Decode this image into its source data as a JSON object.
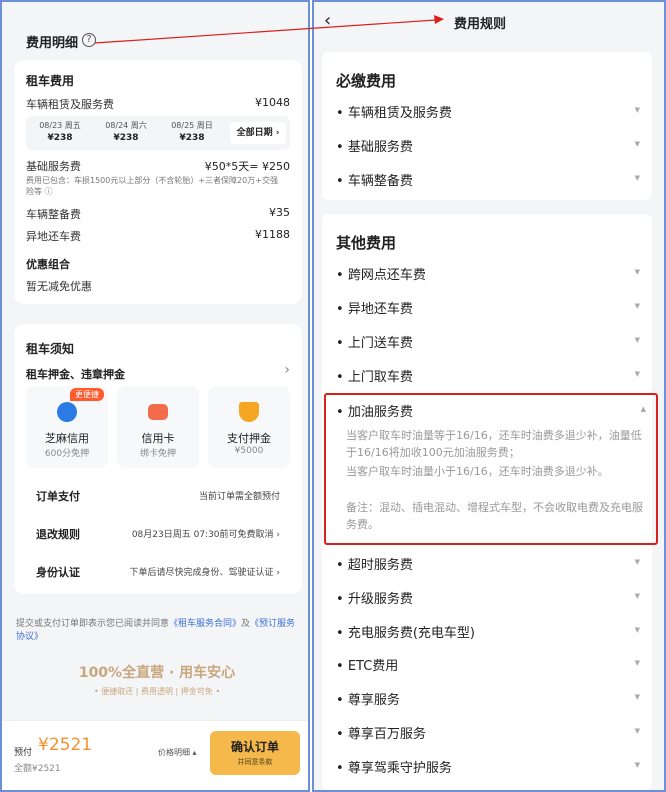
{
  "left": {
    "fee_header": "费用明细",
    "help_icon": "?",
    "rental": {
      "title": "租车费用",
      "rent_label": "车辆租赁及服务费",
      "rent_value": "¥1048",
      "dates": [
        {
          "date": "08/23 周五",
          "price": "¥238"
        },
        {
          "date": "08/24 周六",
          "price": "¥238"
        },
        {
          "date": "08/25 周日",
          "price": "¥238"
        }
      ],
      "all_dates": "全部日期 ›",
      "base_label": "基础服务费",
      "base_value": "¥50*5天= ¥250",
      "base_note": "费用已包含：车损1500元以上部分（不含轮胎）+三者保障20万+交强险等 ⓘ",
      "prep_label": "车辆整备费",
      "prep_value": "¥35",
      "remote_label": "异地还车费",
      "remote_value": "¥1188",
      "discount_title": "优惠组合",
      "discount_value": "暂无减免优惠"
    },
    "notice": {
      "title": "租车须知",
      "deposit_title": "租车押金、违章押金",
      "deposit_chevron": "›",
      "badge": "更便捷",
      "options": [
        {
          "name": "芝麻信用",
          "sub": "600分免押"
        },
        {
          "name": "信用卡",
          "sub": "绑卡免押"
        },
        {
          "name": "支付押金",
          "sub": "¥5000"
        }
      ]
    },
    "order_pay": {
      "label": "订单支付",
      "value": "当前订单需全额预付"
    },
    "refund": {
      "label": "退改规则",
      "value": "08月23日周五 07:30前可免费取消 ›"
    },
    "identity": {
      "label": "身份认证",
      "value": "下单后请尽快完成身份、驾驶证认证 ›"
    },
    "agreement": {
      "prefix": "提交或支付订单即表示您已阅读并同意",
      "link1": "《租车服务合同》",
      "mid": "及",
      "link2": "《预订服务协议》"
    },
    "slogan": "100%全直营 · 用车安心",
    "slogan_sub": "• 便捷取还 | 费用透明 | 押金可免 •",
    "bottom": {
      "prepay_label": "预付",
      "prepay_amount": "¥2521",
      "total": "全额¥2521",
      "price_detail": "价格明细 ▴",
      "confirm": "确认订单",
      "confirm_sub": "并同意条款"
    }
  },
  "right": {
    "back": "‹",
    "title": "费用规则",
    "required_title": "必缴费用",
    "required_items": [
      "车辆租赁及服务费",
      "基础服务费",
      "车辆整备费"
    ],
    "other_title": "其他费用",
    "other_items_top": [
      "跨网点还车费",
      "异地还车费",
      "上门送车费",
      "上门取车费"
    ],
    "expanded_item": "加油服务费",
    "expanded_text": [
      "当客户取车时油量等于16/16，还车时油费多退少补，油量低于16/16将加收100元加油服务费；",
      "当客户取车时油量小于16/16，还车时油费多退少补。",
      "备注：混动、插电混动、增程式车型，不会收取电费及充电服务费。"
    ],
    "other_items_bottom": [
      "超时服务费",
      "升级服务费",
      "充电服务费(充电车型)",
      "ETC费用",
      "尊享服务",
      "尊享百万服务",
      "尊享驾乘守护服务"
    ],
    "caret_down": "▼",
    "caret_up": "▲"
  },
  "colors": {
    "accent": "#f5b84a",
    "price": "#f19330",
    "highlight": "#d9211c",
    "link": "#3a6fd8",
    "badge": "#ff5a2c"
  }
}
